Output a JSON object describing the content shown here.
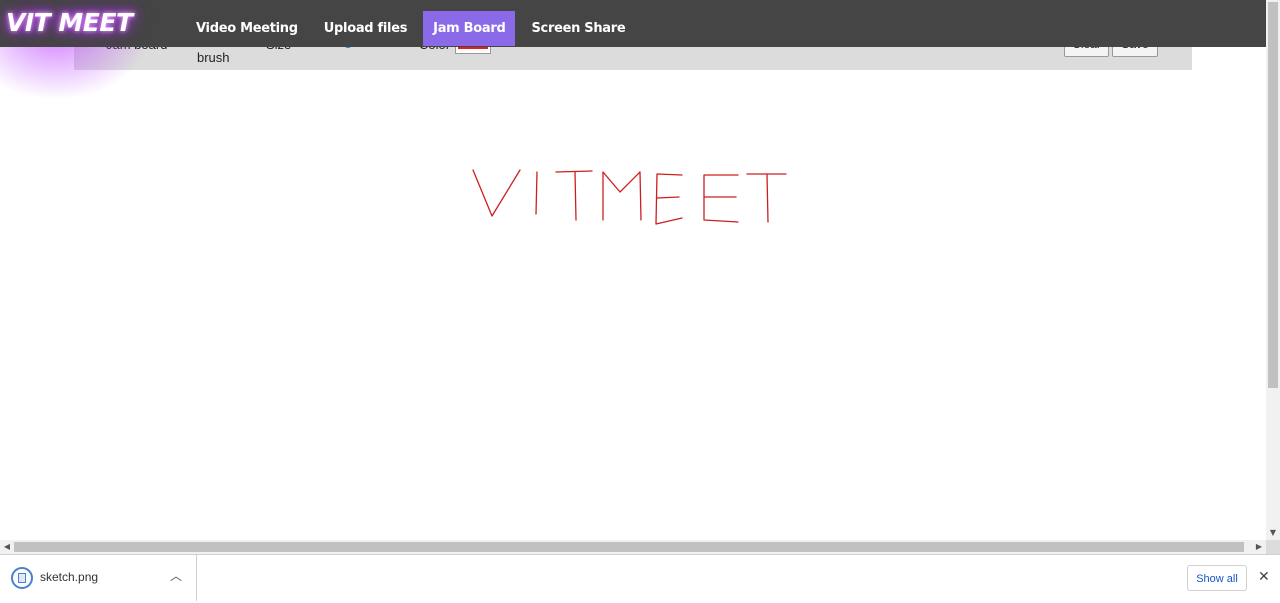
{
  "logo": {
    "text": "VIT MEET"
  },
  "nav": {
    "tabs": [
      {
        "label": "Video Meeting",
        "active": false
      },
      {
        "label": "Upload files",
        "active": false
      },
      {
        "label": "Jam Board",
        "active": true
      },
      {
        "label": "Screen Share",
        "active": false
      }
    ],
    "active_color": "#8a6ae8"
  },
  "toolbar": {
    "title": "Jam board",
    "tool_label": "brush",
    "size_label": "Size",
    "size_value": 90,
    "color_label": "Color",
    "brush_color": "#e02020",
    "clear_label": "Clear",
    "save_label": "Save"
  },
  "canvas": {
    "drawing_text": "VITMEET",
    "stroke_color": "#cc1f1f"
  },
  "downloads": {
    "file_name": "sketch.png",
    "show_all_label": "Show all"
  }
}
